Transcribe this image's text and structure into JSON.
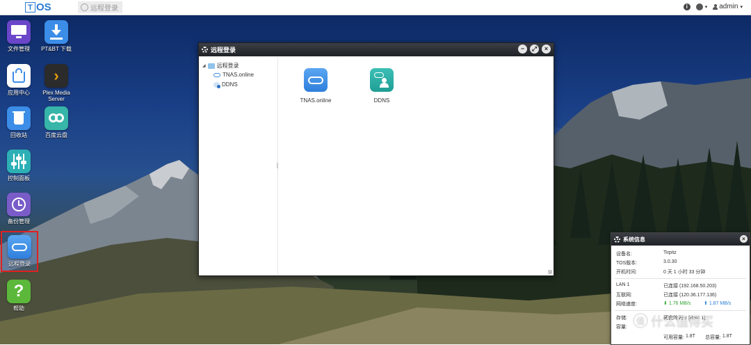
{
  "topbar": {
    "logo_t": "T",
    "logo_os": "OS",
    "task_tab_label": "远程登录",
    "user_label": "admin"
  },
  "desktop_icons": [
    {
      "label": "文件管理",
      "icon": "monitor-icon",
      "color": "#6a46c9"
    },
    {
      "label": "PT&BT 下载",
      "icon": "download-icon",
      "color": "#3b8de8"
    },
    {
      "label": "应用中心",
      "icon": "app-center-icon",
      "color": "#ffffff"
    },
    {
      "label": "Plex Media Server",
      "icon": "plex-icon",
      "color": "#2b2b2b"
    },
    {
      "label": "回收站",
      "icon": "trash-icon",
      "color": "#3b8de8"
    },
    {
      "label": "百度云盘",
      "icon": "baidu-cloud-icon",
      "color": "#36b5a8"
    },
    {
      "label": "控制面板",
      "icon": "sliders-icon",
      "color": "#2cb0b5"
    },
    {
      "label": "备份管理",
      "icon": "backup-clock-icon",
      "color": "#7a5cc8"
    },
    {
      "label": "远程登录",
      "icon": "cloud-icon",
      "color": "#3f8fe6"
    },
    {
      "label": "帮助",
      "icon": "help-icon",
      "color": "#5cb83a"
    }
  ],
  "window": {
    "title": "远程登录",
    "tree": [
      {
        "label": "远程登录"
      },
      {
        "label": "TNAS.online"
      },
      {
        "label": "DDNS"
      }
    ],
    "apps": [
      {
        "label": "TNAS.online"
      },
      {
        "label": "DDNS"
      }
    ]
  },
  "sysinfo": {
    "title": "系统信息",
    "device_name_label": "设备名:",
    "device_name": "Tirpitz",
    "tos_version_label": "TOS版本:",
    "tos_version": "3.0.30",
    "uptime_label": "开机时间:",
    "uptime": "0 天 1 小时 33 分钟",
    "lan_label": "LAN 1",
    "lan_value": "已连接 (192.168.50.203)",
    "internet_label": "互联网:",
    "internet_value": "已连接 (120.36.177.136)",
    "speed_label": "网络速度:",
    "speed_down": "1.76 MB/s",
    "speed_up": "1.87 MB/s",
    "storage_label": "存储:",
    "storage_value": "硬盘阵列-1 [Raid 1]",
    "capacity_label": "容量:",
    "available_label": "可用容量:",
    "available_value": "1.8T",
    "total_label": "总容量:",
    "total_value": "1.8T"
  },
  "watermark": {
    "circle_char": "值",
    "text": "什么值得买"
  }
}
